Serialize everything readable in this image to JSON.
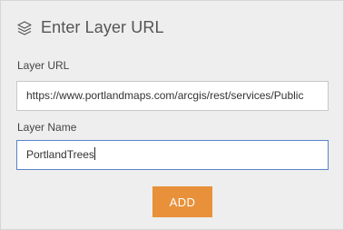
{
  "header": {
    "icon": "layers-icon",
    "title": "Enter Layer URL"
  },
  "form": {
    "layer_url": {
      "label": "Layer URL",
      "value": "https://www.portlandmaps.com/arcgis/rest/services/Public"
    },
    "layer_name": {
      "label": "Layer Name",
      "value": "PortlandTrees"
    },
    "add_label": "ADD"
  },
  "colors": {
    "panel_background": "#eeeeee",
    "add_button": "#e8913a",
    "focused_border": "#5a84c8"
  }
}
